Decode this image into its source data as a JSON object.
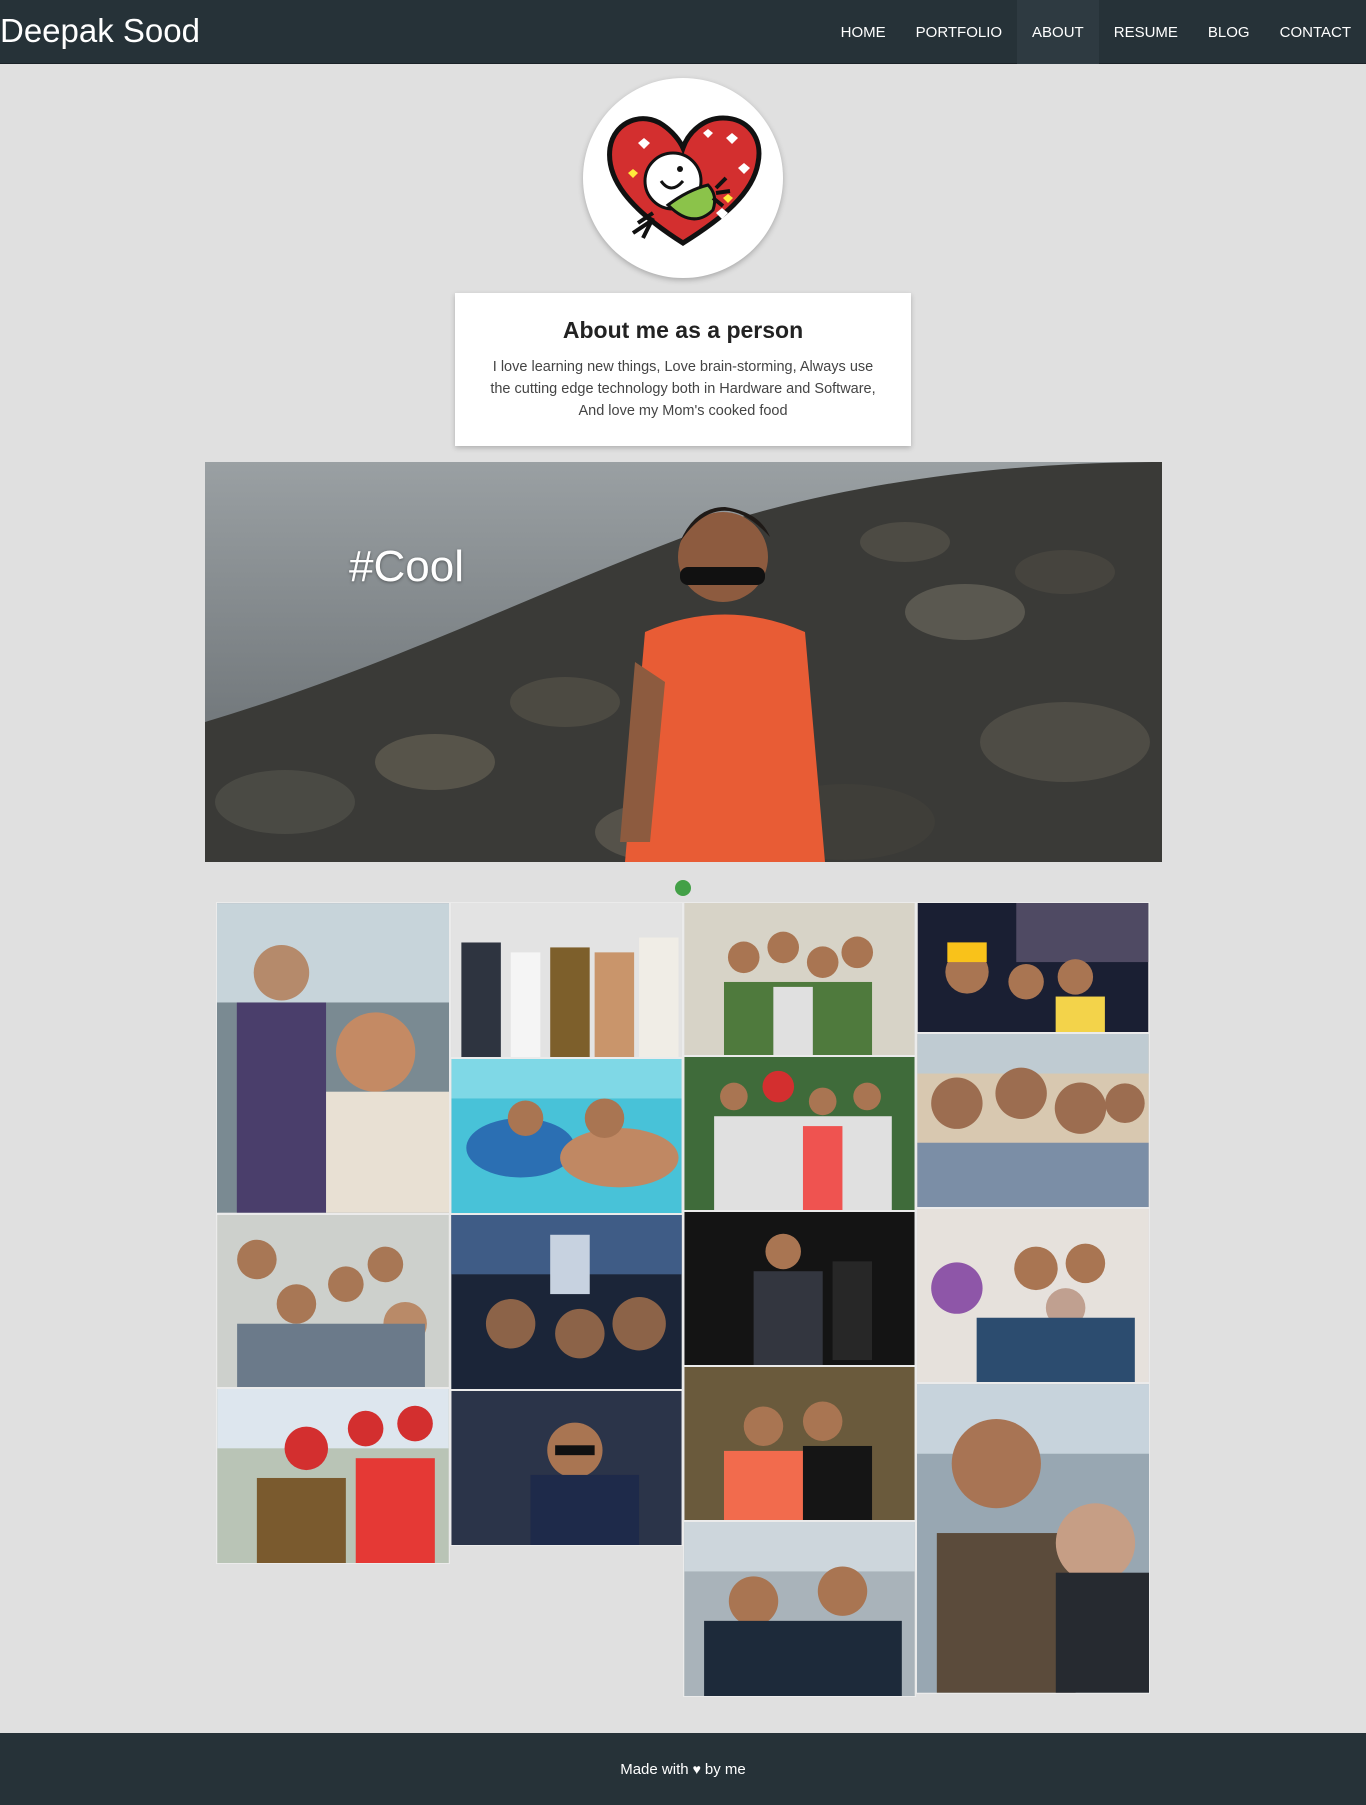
{
  "navbar": {
    "brand": "Deepak Sood",
    "items": [
      {
        "label": "HOME"
      },
      {
        "label": "PORTFOLIO"
      },
      {
        "label": "ABOUT"
      },
      {
        "label": "RESUME"
      },
      {
        "label": "BLOG"
      },
      {
        "label": "CONTACT"
      }
    ],
    "active_item": "ABOUT"
  },
  "avatar": {
    "icon": "heart-smiley-logo"
  },
  "about": {
    "title": "About me as a person",
    "text": "I love learning new things, Love brain-storming, Always use the cutting edge technology both in Hardware and Software, And love my Mom's cooked food"
  },
  "hero": {
    "caption": "#Cool",
    "active_slide": 1
  },
  "footer": {
    "prefix": "Made with",
    "heart": "♥",
    "suffix": "by me"
  },
  "colors": {
    "navbar_bg": "#263238",
    "page_bg": "#e0e0e0",
    "accent_dot": "#43a047",
    "footer_bg": "#263238"
  }
}
